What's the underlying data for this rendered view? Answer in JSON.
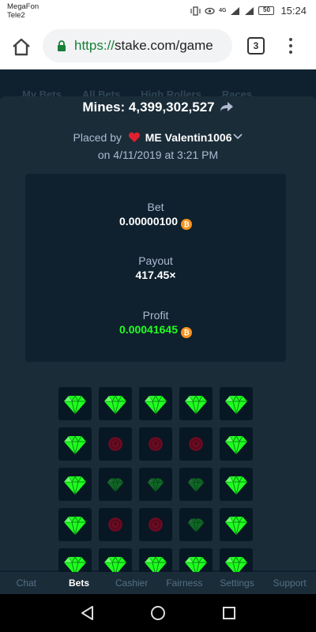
{
  "status_bar": {
    "carrier_1": "MegaFon",
    "carrier_2": "Tele2",
    "network": "4G",
    "battery": "50",
    "time": "15:24"
  },
  "browser": {
    "url_proto": "https://",
    "url_rest": "stake.com/game",
    "tab_count": "3"
  },
  "app_tabs": [
    "My Bets",
    "All Bets",
    "High Rollers",
    "Races"
  ],
  "modal": {
    "title": "Mines: 4,399,302,527",
    "placed_by_prefix": "Placed by",
    "user": "ME Valentin1006",
    "date": "on 4/11/2019 at 3:21 PM",
    "bet_label": "Bet",
    "bet_value": "0.00000100",
    "payout_label": "Payout",
    "payout_value": "417.45×",
    "profit_label": "Profit",
    "profit_value": "0.00041645",
    "coin_icon": "bitcoin-icon"
  },
  "mines_grid": [
    [
      "gem",
      "gem",
      "gem",
      "gem",
      "gem"
    ],
    [
      "gem",
      "mine-dim",
      "mine-dim",
      "mine-dim",
      "gem"
    ],
    [
      "gem",
      "gem-dim",
      "gem-dim",
      "gem-dim",
      "gem"
    ],
    [
      "gem",
      "mine-dim",
      "mine-dim",
      "gem-dim",
      "gem"
    ],
    [
      "gem",
      "gem",
      "gem",
      "gem",
      "gem"
    ]
  ],
  "colors": {
    "gem": "#1fff20",
    "profit": "#1fff20",
    "mine": "#c40020",
    "bitcoin": "#f7931a"
  },
  "bottom_nav": {
    "items": [
      "Chat",
      "Bets",
      "Cashier",
      "Fairness",
      "Settings",
      "Support"
    ],
    "active": "Bets"
  }
}
